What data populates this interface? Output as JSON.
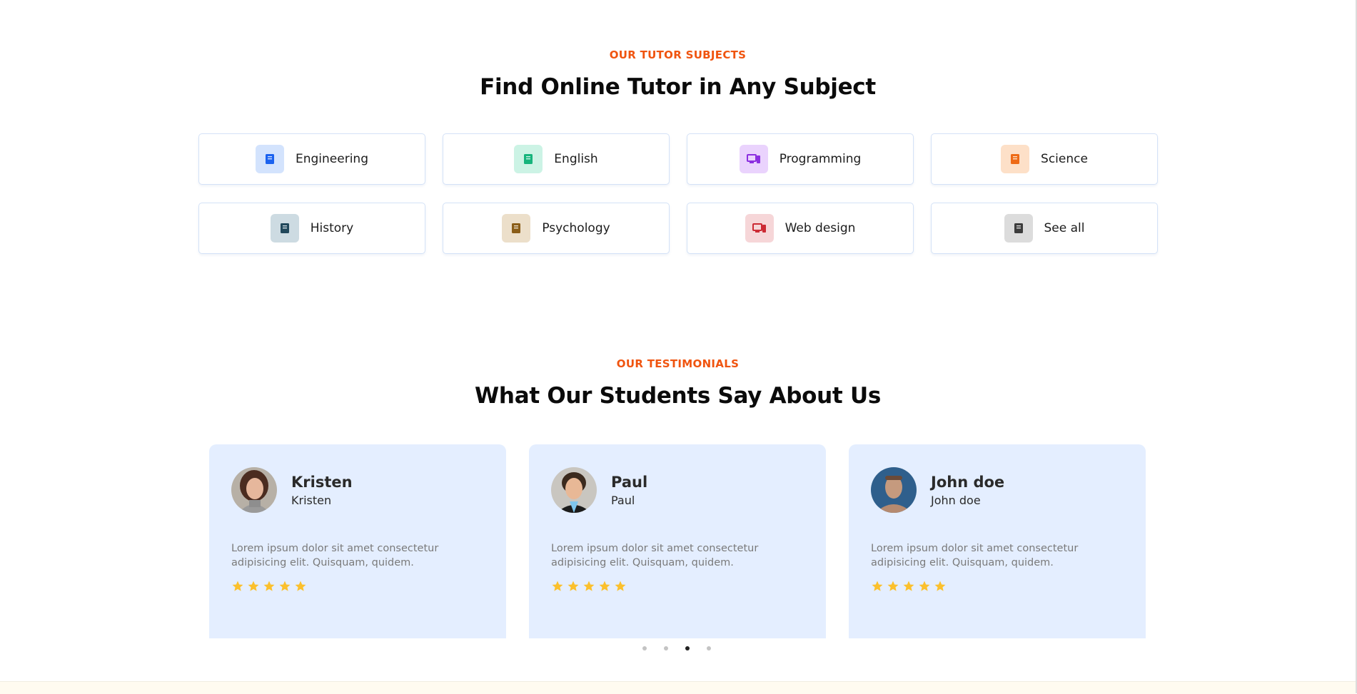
{
  "subjects_section": {
    "eyebrow": "OUR TUTOR SUBJECTS",
    "title": "Find Online Tutor in Any Subject",
    "items": [
      {
        "label": "Engineering",
        "icon": "book-icon",
        "bg": "#d3e3fd",
        "fg": "#1b62ef"
      },
      {
        "label": "English",
        "icon": "book-icon",
        "bg": "#ccf3e5",
        "fg": "#16b47c"
      },
      {
        "label": "Programming",
        "icon": "monitor-icon",
        "bg": "#ead3fd",
        "fg": "#8c2fe0"
      },
      {
        "label": "Science",
        "icon": "book-icon",
        "bg": "#fde0c8",
        "fg": "#ee6a16"
      },
      {
        "label": "History",
        "icon": "book-icon",
        "bg": "#cddbe2",
        "fg": "#21485b"
      },
      {
        "label": "Psychology",
        "icon": "book-icon",
        "bg": "#ecdfca",
        "fg": "#8a5d18"
      },
      {
        "label": "Web design",
        "icon": "monitor-icon",
        "bg": "#f6d6d8",
        "fg": "#cc2a34"
      },
      {
        "label": "See all",
        "icon": "book-icon",
        "bg": "#dcdcdc",
        "fg": "#3c3c3c"
      }
    ]
  },
  "testimonials_section": {
    "eyebrow": "OUR TESTIMONIALS",
    "title": "What Our Students Say About Us",
    "cards": [
      {
        "name": "Kristen",
        "role": "Kristen",
        "quote": "Lorem ipsum dolor sit amet consectetur adipisicing elit. Quisquam, quidem.",
        "rating": 5
      },
      {
        "name": "Paul",
        "role": "Paul",
        "quote": "Lorem ipsum dolor sit amet consectetur adipisicing elit. Quisquam, quidem.",
        "rating": 5
      },
      {
        "name": "John doe",
        "role": "John doe",
        "quote": "Lorem ipsum dolor sit amet consectetur adipisicing elit. Quisquam, quidem.",
        "rating": 5
      }
    ],
    "pagination": {
      "pages": 4,
      "active": 3
    }
  },
  "colors": {
    "accent": "#f0540f",
    "card_bg": "#e4eeff",
    "star": "#fbc02d"
  }
}
